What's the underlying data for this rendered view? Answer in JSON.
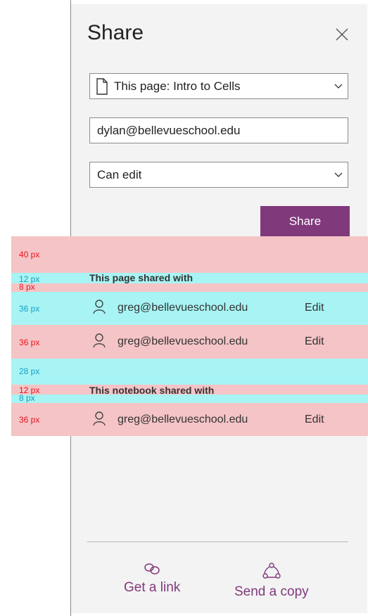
{
  "panel": {
    "title": "Share",
    "page_select": {
      "value": "This page: Intro to Cells"
    },
    "email_field": {
      "value": "dylan@bellevueschool.edu"
    },
    "permission_select": {
      "value": "Can edit"
    },
    "share_button": "Share"
  },
  "page_shared": {
    "heading": "This page shared with",
    "people": [
      {
        "email": "greg@bellevueschool.edu",
        "permission": "Edit"
      },
      {
        "email": "greg@bellevueschool.edu",
        "permission": "Edit"
      }
    ]
  },
  "notebook_shared": {
    "heading": "This notebook shared with",
    "people": [
      {
        "email": "greg@bellevueschool.edu",
        "permission": "Edit"
      }
    ]
  },
  "spacing_annotations": {
    "a": "40 px",
    "b": "12 px",
    "c": "8 px",
    "d": "36 px",
    "e": "36 px",
    "f": "28 px",
    "g": "12 px",
    "h": "8 px",
    "i": "36 px"
  },
  "footer": {
    "get_link": "Get a link",
    "send_copy": "Send a copy"
  },
  "colors": {
    "accent": "#80397b",
    "panel_bg": "#f3f3f3",
    "band_red": "#f5c4c6",
    "band_cyan": "#a8f4f4",
    "label_red": "#e8141e",
    "label_cyan": "#1a9cc4"
  },
  "icons": [
    "page-icon",
    "close-icon",
    "chevron-down-icon",
    "person-icon",
    "link-icon",
    "send-copy-icon"
  ]
}
